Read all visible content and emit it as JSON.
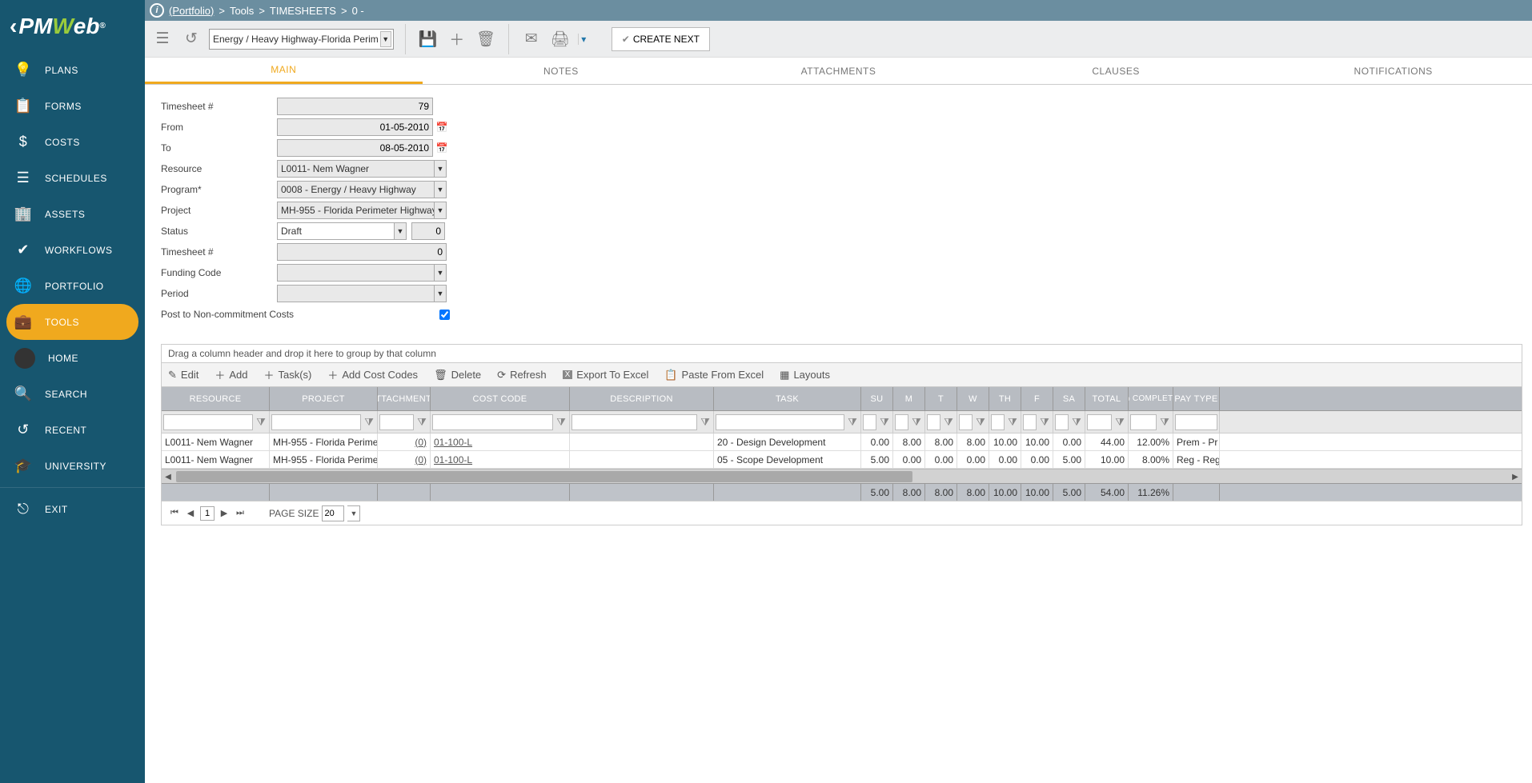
{
  "breadcrumb": {
    "portfolio": "(Portfolio)",
    "sep1": " > ",
    "tools": "Tools",
    "sep2": " > ",
    "timesheets": "TIMESHEETS",
    "sep3": " > ",
    "tail": "0 -"
  },
  "toolbar": {
    "project_select": "Energy / Heavy Highway-Florida Perim",
    "create_next": "CREATE NEXT"
  },
  "sidebar": {
    "items": [
      "PLANS",
      "FORMS",
      "COSTS",
      "SCHEDULES",
      "ASSETS",
      "WORKFLOWS",
      "PORTFOLIO",
      "TOOLS",
      "HOME",
      "SEARCH",
      "RECENT",
      "UNIVERSITY",
      "EXIT"
    ]
  },
  "tabs": [
    "MAIN",
    "NOTES",
    "ATTACHMENTS",
    "CLAUSES",
    "NOTIFICATIONS"
  ],
  "form": {
    "labels": {
      "timesheet_no": "Timesheet #",
      "from": "From",
      "to": "To",
      "resource": "Resource",
      "program": "Program*",
      "project": "Project",
      "status": "Status",
      "timesheet_no2": "Timesheet #",
      "funding": "Funding Code",
      "period": "Period",
      "post": "Post to Non-commitment Costs"
    },
    "values": {
      "timesheet_no": "79",
      "from": "01-05-2010",
      "to": "08-05-2010",
      "resource": "L0011- Nem Wagner",
      "program": "0008 - Energy / Heavy Highway",
      "project": "MH-955 - Florida Perimeter Highway",
      "status": "Draft",
      "status_num": "0",
      "timesheet_no2": "0",
      "funding": "",
      "period": ""
    }
  },
  "grid": {
    "group_hint": "Drag a column header and drop it here to group by that column",
    "toolbar": {
      "edit": "Edit",
      "add": "Add",
      "tasks": "Task(s)",
      "addcost": "Add Cost Codes",
      "delete": "Delete",
      "refresh": "Refresh",
      "export": "Export To Excel",
      "paste": "Paste From Excel",
      "layouts": "Layouts"
    },
    "columns": [
      "RESOURCE",
      "PROJECT",
      "ATTACHMENTS",
      "COST CODE",
      "DESCRIPTION",
      "TASK",
      "SU",
      "M",
      "T",
      "W",
      "TH",
      "F",
      "SA",
      "TOTAL",
      "% COMPLETE",
      "PAY TYPE"
    ],
    "rows": [
      {
        "resource": "L0011- Nem Wagner",
        "project": "MH-955 - Florida Perime",
        "att": "(0)",
        "cost": "01-100-L",
        "desc": "",
        "task": "20 - Design Development",
        "su": "0.00",
        "m": "8.00",
        "t": "8.00",
        "w": "8.00",
        "th": "10.00",
        "f": "10.00",
        "sa": "0.00",
        "total": "44.00",
        "comp": "12.00%",
        "pay": "Prem - Pr"
      },
      {
        "resource": "L0011- Nem Wagner",
        "project": "MH-955 - Florida Perime",
        "att": "(0)",
        "cost": "01-100-L",
        "desc": "",
        "task": "05 - Scope Development",
        "su": "5.00",
        "m": "0.00",
        "t": "0.00",
        "w": "0.00",
        "th": "0.00",
        "f": "0.00",
        "sa": "5.00",
        "total": "10.00",
        "comp": "8.00%",
        "pay": "Reg - Reg"
      }
    ],
    "totals": {
      "su": "5.00",
      "m": "8.00",
      "t": "8.00",
      "w": "8.00",
      "th": "10.00",
      "f": "10.00",
      "sa": "5.00",
      "total": "54.00",
      "comp": "11.26%"
    },
    "pager": {
      "page": "1",
      "page_size_label": "PAGE SIZE",
      "page_size": "20"
    }
  }
}
